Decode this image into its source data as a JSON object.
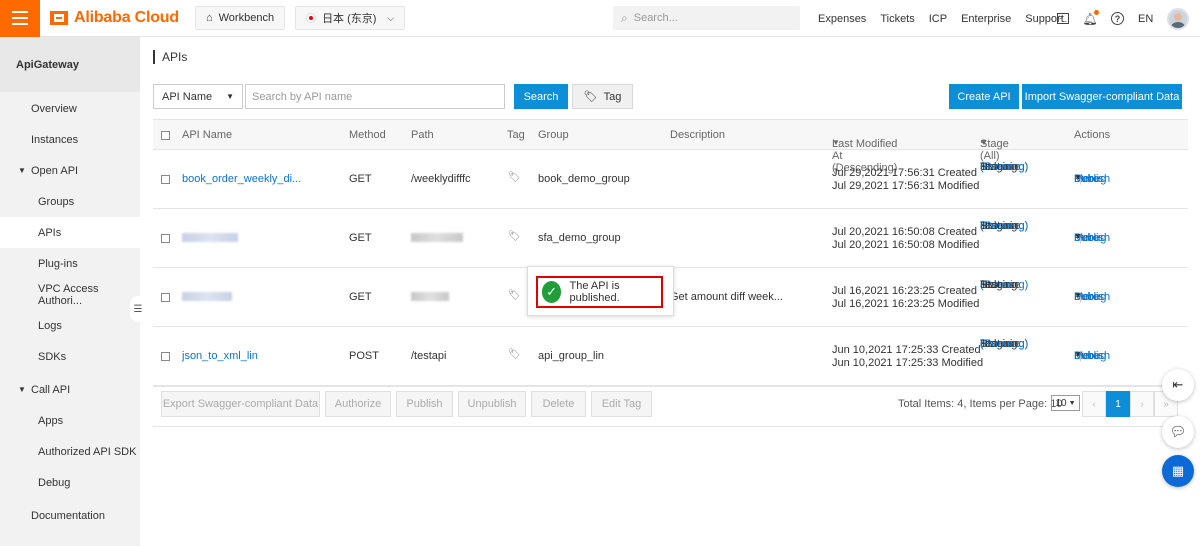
{
  "topbar": {
    "brand": "Alibaba Cloud",
    "workbench": "Workbench",
    "region": "日本 (东京)",
    "search_placeholder": "Search...",
    "nav": [
      "Expenses",
      "Tickets",
      "ICP",
      "Enterprise",
      "Support"
    ],
    "lang": "EN"
  },
  "sidebar": {
    "title": "ApiGateway",
    "items": [
      {
        "label": "Overview"
      },
      {
        "label": "Instances"
      },
      {
        "label": "Open API"
      },
      {
        "label": "Groups"
      },
      {
        "label": "APIs"
      },
      {
        "label": "Plug-ins"
      },
      {
        "label": "VPC Access Authori..."
      },
      {
        "label": "Logs"
      },
      {
        "label": "SDKs"
      },
      {
        "label": "Call API"
      },
      {
        "label": "Apps"
      },
      {
        "label": "Authorized API SDK"
      },
      {
        "label": "Debug"
      },
      {
        "label": "Documentation"
      }
    ]
  },
  "page": {
    "title": "APIs",
    "filter_value": "API Name",
    "search_placeholder": "Search by API name",
    "search_btn": "Search",
    "tag_btn": "Tag",
    "create_btn": "Create API",
    "import_btn": "Import Swagger-compliant Data"
  },
  "table": {
    "headers": {
      "name": "API Name",
      "method": "Method",
      "path": "Path",
      "tag": "Tag",
      "group": "Group",
      "description": "Description",
      "modified": "Last Modified At (Descending)",
      "stage": "Stage (All)",
      "actions": "Actions"
    },
    "rows": [
      {
        "name": "book_order_weekly_di...",
        "method": "GET",
        "path": "/weeklydifffc",
        "group": "book_demo_group",
        "description": "",
        "created": "Jul 29,2021 17:56:31 Created",
        "modified": "Jul 29,2021 17:56:31 Modified",
        "release": "Release",
        "release_status": "(Running)",
        "staging": "Staging",
        "staging_status": "",
        "test": "Test",
        "test_status": "(Running)"
      },
      {
        "name": "",
        "method": "GET",
        "path": "",
        "group": "sfa_demo_group",
        "description": "",
        "created": "Jul 20,2021 16:50:08 Created",
        "modified": "Jul 20,2021 16:50:08 Modified",
        "release": "Release",
        "release_status": "(Running)",
        "staging": "Staging",
        "staging_status": "",
        "test": "Test",
        "test_status": "(Running)"
      },
      {
        "name": "",
        "method": "GET",
        "path": "",
        "group": "",
        "description": "Get amount diff week...",
        "created": "Jul 16,2021 16:23:25 Created",
        "modified": "Jul 16,2021 16:23:25 Modified",
        "release": "Release",
        "release_status": "(Running)",
        "staging": "Staging",
        "staging_status": "",
        "test": "Test",
        "test_status": ""
      },
      {
        "name": "json_to_xml_lin",
        "method": "POST",
        "path": "/testapi",
        "group": "api_group_lin",
        "description": "",
        "created": "Jun 10,2021 17:25:33 Created",
        "modified": "Jun 10,2021 17:25:33 Modified",
        "release": "Release",
        "release_status": "(Running)",
        "staging": "Staging",
        "staging_status": "",
        "test": "Test",
        "test_status": "(Running)"
      }
    ],
    "actions": {
      "publish": "Publish",
      "debug": "Debug",
      "more": "More"
    }
  },
  "footer": {
    "buttons": [
      "Export Swagger-compliant Data",
      "Authorize",
      "Publish",
      "Unpublish",
      "Delete",
      "Edit Tag"
    ],
    "total": "Total Items: 4, Items per Page: 10",
    "per_page": "10",
    "current_page": "1"
  },
  "toast": {
    "message": "The API is published."
  },
  "colors": {
    "brand": "#ff6a00",
    "primary": "#0c8fd6",
    "link": "#0c72c9",
    "success": "#1f9e3a",
    "highlight": "#e00000"
  }
}
